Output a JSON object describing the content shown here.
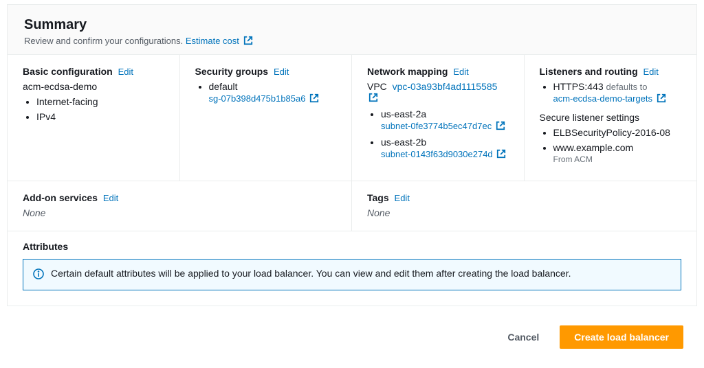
{
  "summary": {
    "title": "Summary",
    "subtitle": "Review and confirm your configurations.",
    "estimate_cost": "Estimate cost"
  },
  "basic": {
    "heading": "Basic configuration",
    "edit": "Edit",
    "name": "acm-ecdsa-demo",
    "scheme": "Internet-facing",
    "ip_type": "IPv4"
  },
  "security": {
    "heading": "Security groups",
    "edit": "Edit",
    "group_name": "default",
    "group_id": "sg-07b398d475b1b85a6"
  },
  "network": {
    "heading": "Network mapping",
    "edit": "Edit",
    "vpc_label": "VPC",
    "vpc_id": "vpc-03a93bf4ad1115585",
    "az1": "us-east-2a",
    "subnet1": "subnet-0fe3774b5ec47d7ec",
    "az2": "us-east-2b",
    "subnet2": "subnet-0143f63d9030e274d"
  },
  "listeners": {
    "heading": "Listeners and routing",
    "edit": "Edit",
    "listener": "HTTPS:443",
    "defaults_to": "defaults to",
    "target": "acm-ecdsa-demo-targets",
    "secure_heading": "Secure listener settings",
    "policy": "ELBSecurityPolicy-2016-08",
    "cert": "www.example.com",
    "cert_from": "From ACM"
  },
  "addons": {
    "heading": "Add-on services",
    "edit": "Edit",
    "value": "None"
  },
  "tags": {
    "heading": "Tags",
    "edit": "Edit",
    "value": "None"
  },
  "attributes": {
    "heading": "Attributes",
    "info": "Certain default attributes will be applied to your load balancer. You can view and edit them after creating the load balancer."
  },
  "footer": {
    "cancel": "Cancel",
    "create": "Create load balancer"
  }
}
